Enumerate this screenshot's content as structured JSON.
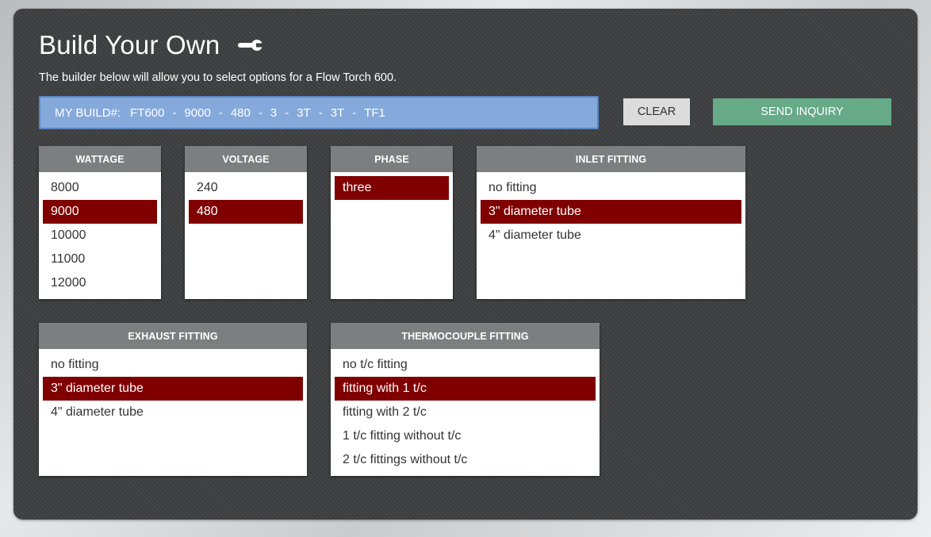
{
  "header": {
    "title": "Build Your Own",
    "icon": "wrench-icon"
  },
  "subtitle": "The builder below will allow you to select options for a Flow Torch 600.",
  "build": {
    "label": "MY BUILD#:",
    "segments": [
      "FT600",
      "9000",
      "480",
      "3",
      "3T",
      "3T",
      "TF1"
    ],
    "separator": "-"
  },
  "buttons": {
    "clear": "CLEAR",
    "send": "SEND INQUIRY"
  },
  "colors": {
    "selected": "#800000",
    "build_bar": "#86a9db",
    "send": "#66aa88",
    "header": "#7d7e7f"
  },
  "groups": {
    "wattage": {
      "title": "WATTAGE",
      "options": [
        "8000",
        "9000",
        "10000",
        "11000",
        "12000"
      ],
      "selected": "9000"
    },
    "voltage": {
      "title": "VOLTAGE",
      "options": [
        "240",
        "480"
      ],
      "selected": "480"
    },
    "phase": {
      "title": "PHASE",
      "options": [
        "three"
      ],
      "selected": "three"
    },
    "inlet": {
      "title": "INLET FITTING",
      "options": [
        "no fitting",
        "3\" diameter tube",
        "4\" diameter tube"
      ],
      "selected": "3\" diameter tube"
    },
    "exhaust": {
      "title": "EXHAUST FITTING",
      "options": [
        "no fitting",
        "3\" diameter tube",
        "4\" diameter tube"
      ],
      "selected": "3\" diameter tube"
    },
    "thermocouple": {
      "title": "THERMOCOUPLE FITTING",
      "options": [
        "no t/c fitting",
        "fitting with 1 t/c",
        "fitting with 2 t/c",
        "1 t/c fitting without t/c",
        "2 t/c fittings without t/c"
      ],
      "selected": "fitting with 1 t/c"
    }
  }
}
